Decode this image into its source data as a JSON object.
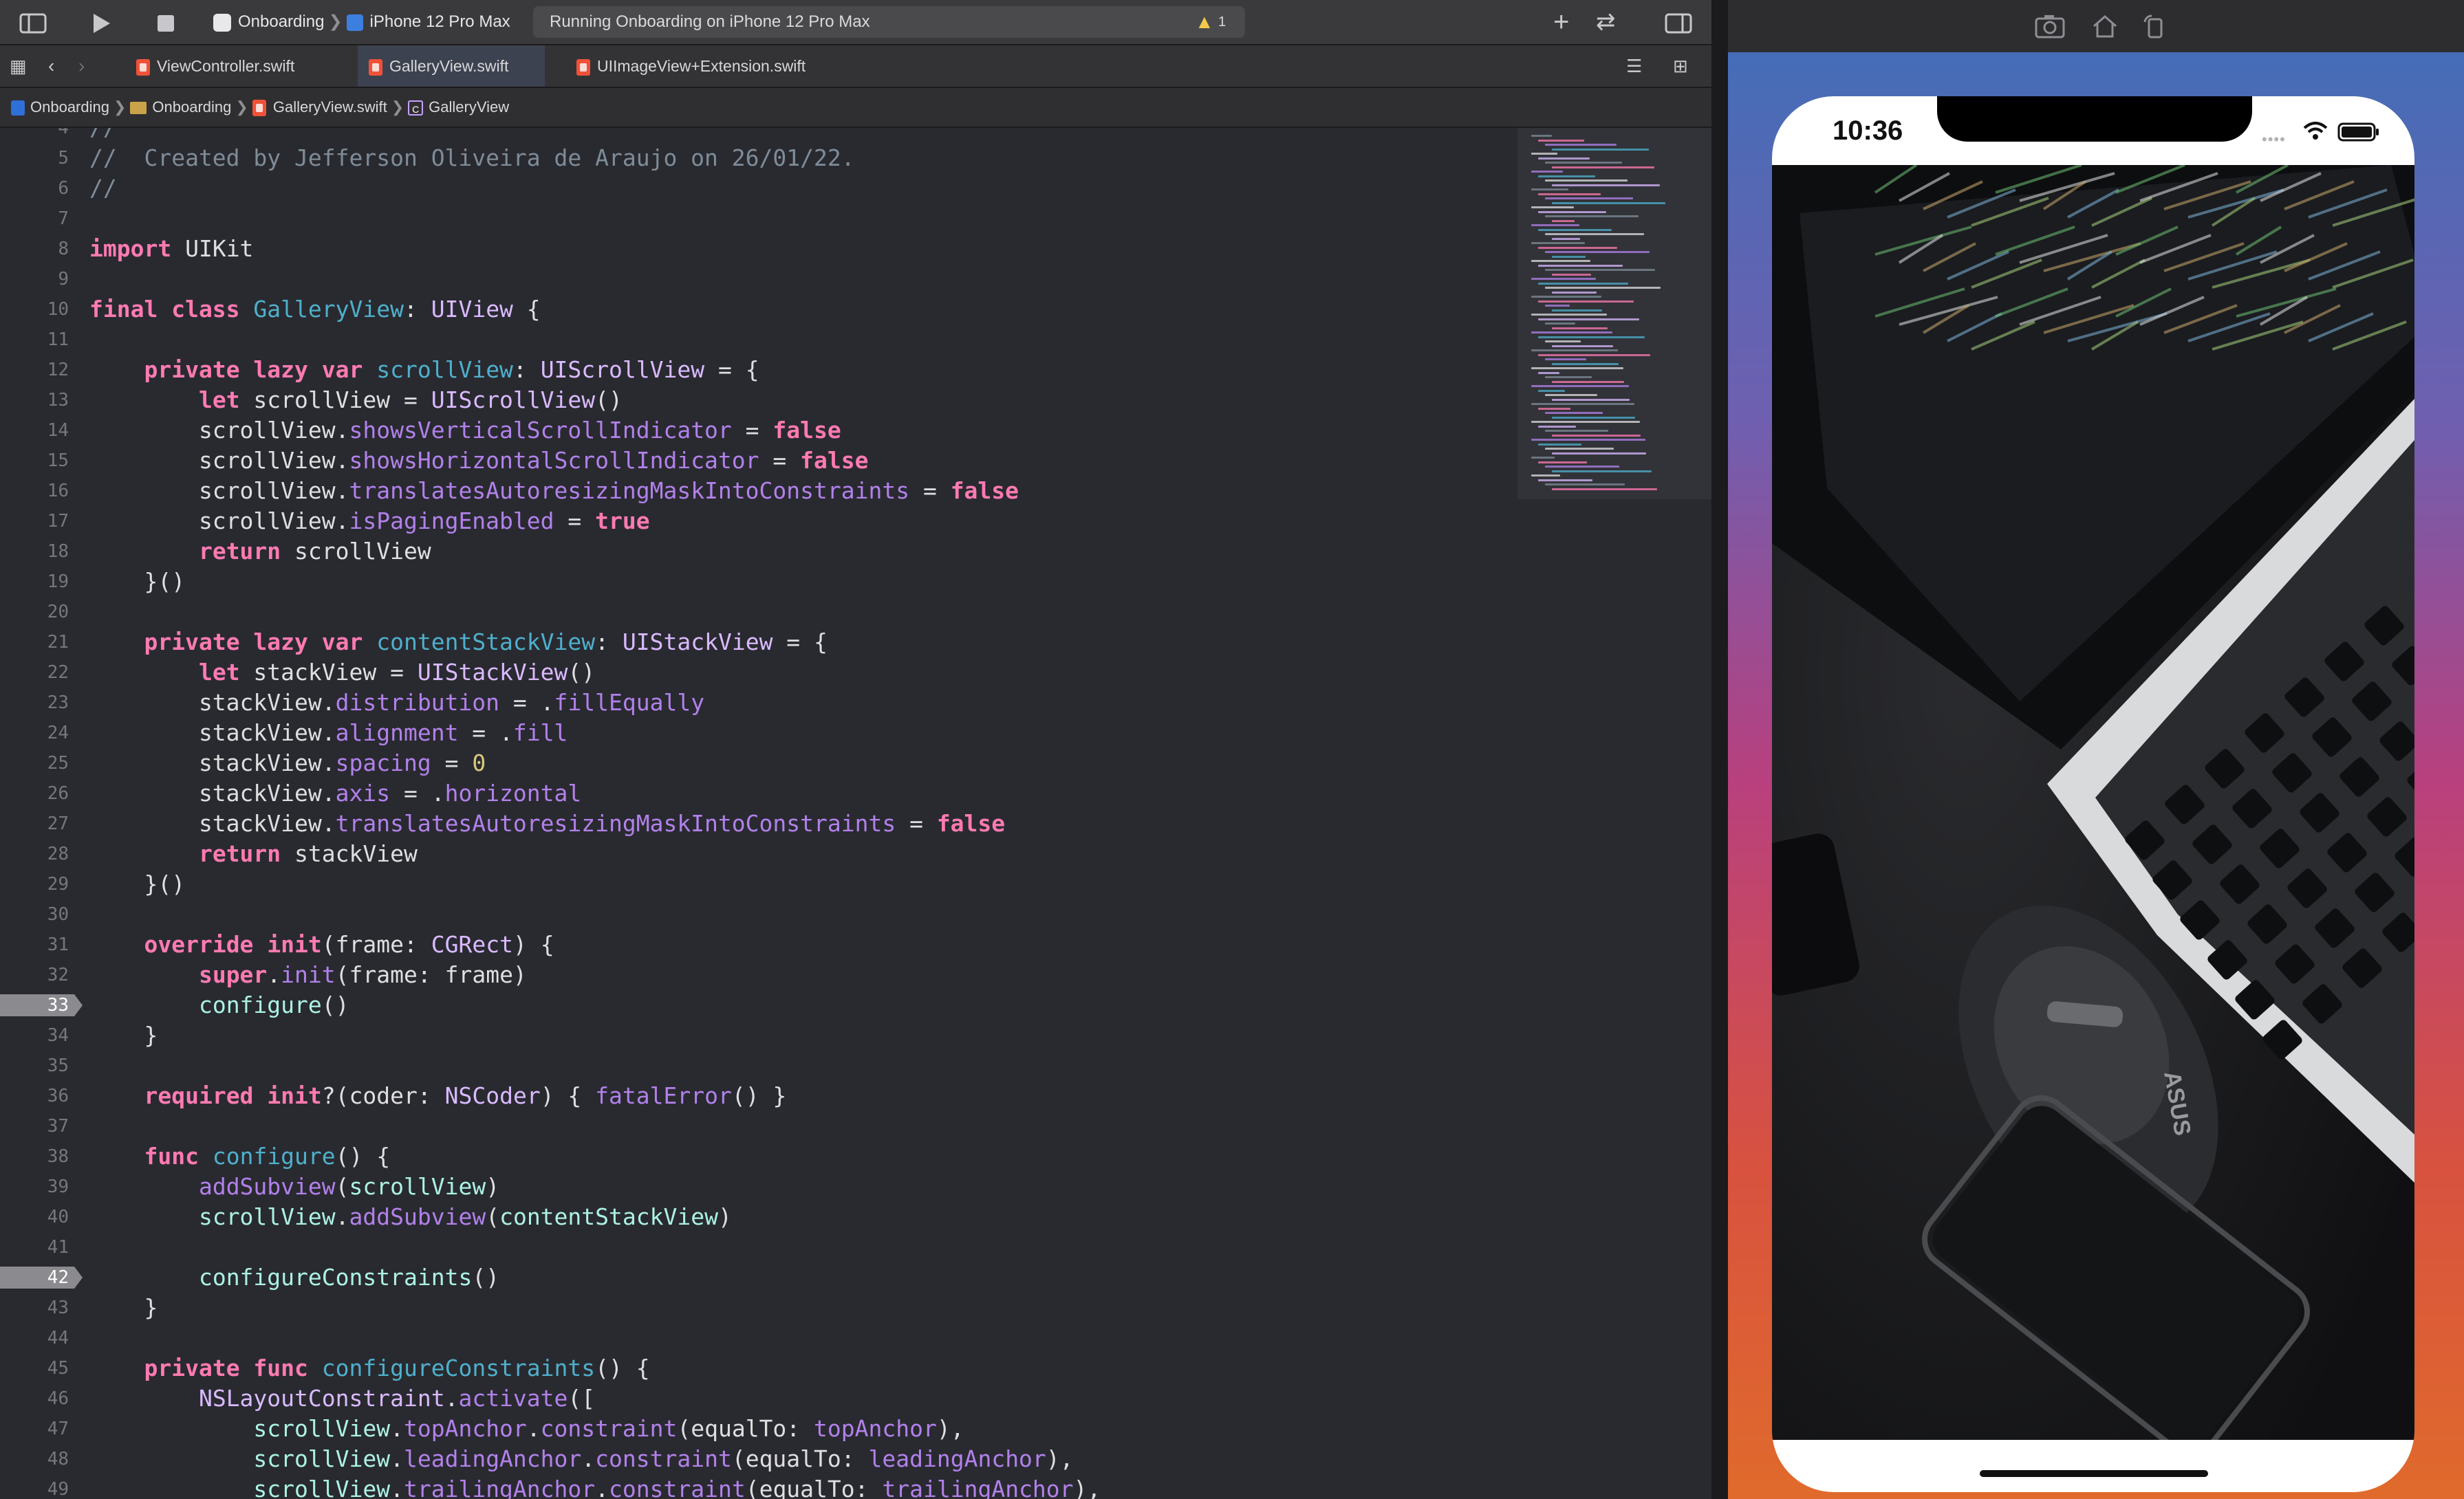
{
  "toolbar": {
    "project": "Onboarding",
    "device": "iPhone 12 Pro Max",
    "status_text": "Running Onboarding on iPhone 12 Pro Max",
    "warning_count": "1"
  },
  "tabs": [
    {
      "label": "ViewController.swift"
    },
    {
      "label": "GalleryView.swift"
    },
    {
      "label": "UIImageView+Extension.swift"
    }
  ],
  "breadcrumb": [
    "Onboarding",
    "Onboarding",
    "GalleryView.swift",
    "GalleryView"
  ],
  "code_lines": [
    {
      "n": "4",
      "bp": false,
      "html": "<span class='cm'>//</span>"
    },
    {
      "n": "5",
      "bp": false,
      "html": "<span class='cm'>//  Created by Jefferson Oliveira de Araujo on 26/01/22.</span>"
    },
    {
      "n": "6",
      "bp": false,
      "html": "<span class='cm'>//</span>"
    },
    {
      "n": "7",
      "bp": false,
      "html": ""
    },
    {
      "n": "8",
      "bp": false,
      "html": "<span class='kw'>import</span> UIKit"
    },
    {
      "n": "9",
      "bp": false,
      "html": ""
    },
    {
      "n": "10",
      "bp": false,
      "html": "<span class='kw'>final class</span> <span class='id'>GalleryView</span>: <span class='tp'>UIView</span> {"
    },
    {
      "n": "11",
      "bp": false,
      "html": ""
    },
    {
      "n": "12",
      "bp": false,
      "html": "    <span class='kw'>private lazy var</span> <span class='id'>scrollView</span>: <span class='tp'>UIScrollView</span> = {"
    },
    {
      "n": "13",
      "bp": false,
      "html": "        <span class='kw'>let</span> scrollView = <span class='tp'>UIScrollView</span>()"
    },
    {
      "n": "14",
      "bp": false,
      "html": "        scrollView.<span class='pr'>showsVerticalScrollIndicator</span> = <span class='kw'>false</span>"
    },
    {
      "n": "15",
      "bp": false,
      "html": "        scrollView.<span class='pr'>showsHorizontalScrollIndicator</span> = <span class='kw'>false</span>"
    },
    {
      "n": "16",
      "bp": false,
      "html": "        scrollView.<span class='pr'>translatesAutoresizingMaskIntoConstraints</span> = <span class='kw'>false</span>"
    },
    {
      "n": "17",
      "bp": false,
      "html": "        scrollView.<span class='pr'>isPagingEnabled</span> = <span class='kw'>true</span>"
    },
    {
      "n": "18",
      "bp": false,
      "html": "        <span class='kw'>return</span> scrollView"
    },
    {
      "n": "19",
      "bp": false,
      "html": "    }()"
    },
    {
      "n": "20",
      "bp": false,
      "html": ""
    },
    {
      "n": "21",
      "bp": false,
      "html": "    <span class='kw'>private lazy var</span> <span class='id'>contentStackView</span>: <span class='tp'>UIStackView</span> = {"
    },
    {
      "n": "22",
      "bp": false,
      "html": "        <span class='kw'>let</span> stackView = <span class='tp'>UIStackView</span>()"
    },
    {
      "n": "23",
      "bp": false,
      "html": "        stackView.<span class='pr'>distribution</span> = .<span class='pr'>fillEqually</span>"
    },
    {
      "n": "24",
      "bp": false,
      "html": "        stackView.<span class='pr'>alignment</span> = .<span class='pr'>fill</span>"
    },
    {
      "n": "25",
      "bp": false,
      "html": "        stackView.<span class='pr'>spacing</span> = <span class='nm'>0</span>"
    },
    {
      "n": "26",
      "bp": false,
      "html": "        stackView.<span class='pr'>axis</span> = .<span class='pr'>horizontal</span>"
    },
    {
      "n": "27",
      "bp": false,
      "html": "        stackView.<span class='pr'>translatesAutoresizingMaskIntoConstraints</span> = <span class='kw'>false</span>"
    },
    {
      "n": "28",
      "bp": false,
      "html": "        <span class='kw'>return</span> stackView"
    },
    {
      "n": "29",
      "bp": false,
      "html": "    }()"
    },
    {
      "n": "30",
      "bp": false,
      "html": ""
    },
    {
      "n": "31",
      "bp": false,
      "html": "    <span class='kw'>override</span> <span class='kw'>init</span>(frame: <span class='tp'>CGRect</span>) {"
    },
    {
      "n": "32",
      "bp": false,
      "html": "        <span class='kw'>super</span>.<span class='pr'>init</span>(frame: frame)"
    },
    {
      "n": "33",
      "bp": true,
      "html": "        <span class='fn'>configure</span>()"
    },
    {
      "n": "34",
      "bp": false,
      "html": "    }"
    },
    {
      "n": "35",
      "bp": false,
      "html": ""
    },
    {
      "n": "36",
      "bp": false,
      "html": "    <span class='kw'>required</span> <span class='kw'>init</span>?(coder: <span class='tp'>NSCoder</span>) { <span class='pr'>fatalError</span>() }"
    },
    {
      "n": "37",
      "bp": false,
      "html": ""
    },
    {
      "n": "38",
      "bp": false,
      "html": "    <span class='kw'>func</span> <span class='id'>configure</span>() {"
    },
    {
      "n": "39",
      "bp": false,
      "html": "        <span class='pr'>addSubview</span>(<span class='fn'>scrollView</span>)"
    },
    {
      "n": "40",
      "bp": false,
      "html": "        <span class='fn'>scrollView</span>.<span class='pr'>addSubview</span>(<span class='fn'>contentStackView</span>)"
    },
    {
      "n": "41",
      "bp": false,
      "html": ""
    },
    {
      "n": "42",
      "bp": true,
      "html": "        <span class='fn'>configureConstraints</span>()"
    },
    {
      "n": "43",
      "bp": false,
      "html": "    }"
    },
    {
      "n": "44",
      "bp": false,
      "html": ""
    },
    {
      "n": "45",
      "bp": false,
      "html": "    <span class='kw'>private func</span> <span class='id'>configureConstraints</span>() {"
    },
    {
      "n": "46",
      "bp": false,
      "html": "        <span class='tp'>NSLayoutConstraint</span>.<span class='pr'>activate</span>(["
    },
    {
      "n": "47",
      "bp": false,
      "html": "            <span class='fn'>scrollView</span>.<span class='pr'>topAnchor</span>.<span class='pr'>constraint</span>(equalTo: <span class='pr'>topAnchor</span>),"
    },
    {
      "n": "48",
      "bp": false,
      "html": "            <span class='fn'>scrollView</span>.<span class='pr'>leadingAnchor</span>.<span class='pr'>constraint</span>(equalTo: <span class='pr'>leadingAnchor</span>),"
    },
    {
      "n": "49",
      "bp": false,
      "html": "            <span class='fn'>scrollView</span>.<span class='pr'>trailingAnchor</span>.<span class='pr'>constraint</span>(equalTo: <span class='pr'>trailingAnchor</span>),"
    }
  ],
  "simulator": {
    "time": "10:36"
  },
  "colors": {
    "editor_bg": "#292a30",
    "keyword": "#ff7ab2",
    "comment": "#7f8c98",
    "type": "#dabaff",
    "declaration": "#4eb0cc",
    "property": "#b281eb",
    "number": "#d9c97c",
    "function": "#acf2e4"
  }
}
